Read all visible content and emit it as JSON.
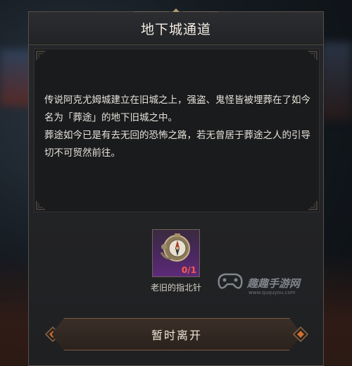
{
  "dialog": {
    "title": "地下城通道",
    "description_lines": [
      "传说阿克尤姆城建立在旧城之上，强盗、鬼怪皆被埋葬在了如今名为「葬途」的地下旧城之中。",
      "葬途如今已是有去无回的恐怖之路，若无曾居于葬途之人的引导切不可贸然前往。"
    ]
  },
  "required_item": {
    "name": "老旧的指北针",
    "count": "0/1",
    "icon": "compass-icon"
  },
  "actions": {
    "leave_label": "暂时离开"
  },
  "watermark": {
    "text": "趣趣手游网",
    "url": "www.ququyou.com"
  },
  "colors": {
    "panel_bg": "#222326",
    "text": "#e6e2da",
    "count_red": "#ff5a4a",
    "item_purple": "#5e2a78",
    "button_border": "#7a5a40"
  }
}
